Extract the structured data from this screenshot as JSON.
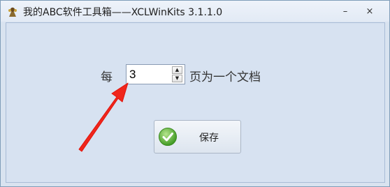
{
  "window": {
    "title": "我的ABC软件工具箱——XCLWinKits  3.1.1.0",
    "minimize_glyph": "–",
    "close_glyph": "×"
  },
  "form": {
    "label_prefix": "每",
    "pages_value": "3",
    "label_suffix": "页为一个文档",
    "spin_up_glyph": "▲",
    "spin_down_glyph": "▼"
  },
  "save_button": {
    "label": "保存",
    "icon": "check-icon"
  },
  "annotation": {
    "arrow_icon": "red-arrow-icon",
    "arrow_color": "#f0261c"
  },
  "colors": {
    "window_bg": "#d7e2f1",
    "check_green": "#5fb13a"
  }
}
